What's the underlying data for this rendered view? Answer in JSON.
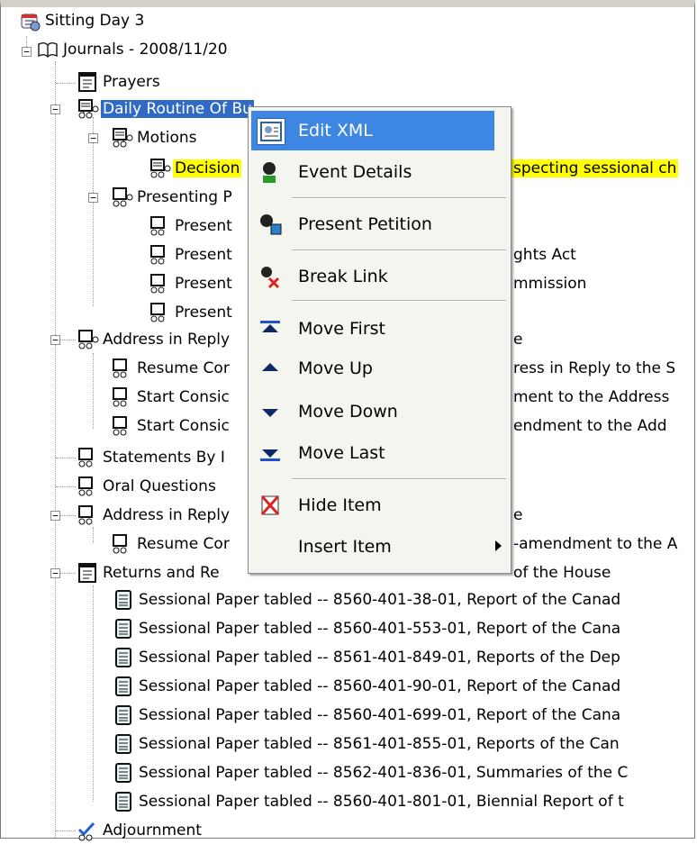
{
  "tree": {
    "root": "Sitting Day 3",
    "journal": "Journals - 2008/11/20",
    "items": [
      "Prayers",
      "Daily Routine Of Business",
      "Motions",
      "Decision on motion respecting sessional changes",
      "Presenting Petitions",
      "Present",
      "Present ... ghts Act",
      "Present ... mmission",
      "Present",
      "Address in Reply to the Speech from the Throne",
      "Resume Consideration of the Address in Reply to the S",
      "Start Consideration of amendment to the Address",
      "Start Consideration of sub-amendment to the Add",
      "Statements By Members",
      "Oral Questions",
      "Address in Reply to the Speech from the Throne",
      "Resume Consideration of sub-amendment to the A",
      "Returns and Reports Deposited with the Clerk of the House",
      "Sessional Paper tabled -- 8560-401-38-01, Report of the Canad",
      "Sessional Paper tabled -- 8560-401-553-01, Report of the Cana",
      "Sessional Paper tabled -- 8561-401-849-01, Reports of the Dep",
      "Sessional Paper tabled -- 8560-401-90-01, Report of the Canad",
      "Sessional Paper tabled -- 8560-401-699-01, Report of the Cana",
      "Sessional Paper tabled -- 8561-401-855-01, Reports of the Can",
      "Sessional Paper tabled -- 8562-401-836-01, Summaries of the C",
      "Sessional Paper tabled -- 8560-401-801-01, Biennial Report of t",
      "Adjournment"
    ],
    "visible_labels": [
      "Prayers",
      "Daily Routine Of Bu",
      "Motions",
      "Decision",
      "specting sessional ch",
      "Presenting P",
      "Present",
      "Present",
      "ghts Act",
      "Present",
      "mmission",
      "Present",
      "Address in Reply",
      "e",
      "Resume Cor",
      "ress in Reply to the S",
      "Start Consic",
      "ment to the Address",
      "Start Consic",
      "endment to the Add",
      "Statements By I",
      "Oral Questions",
      "Address in Reply",
      "e",
      "Resume Cor",
      "-amendment to the A",
      "Returns and Re",
      "of the House"
    ],
    "papers": [
      "Sessional Paper tabled -- 8560-401-38-01, Report of the Canad",
      "Sessional Paper tabled -- 8560-401-553-01, Report of the Cana",
      "Sessional Paper tabled -- 8561-401-849-01, Reports of the Dep",
      "Sessional Paper tabled -- 8560-401-90-01, Report of the Canad",
      "Sessional Paper tabled -- 8560-401-699-01, Report of the Cana",
      "Sessional Paper tabled -- 8561-401-855-01, Reports of the Can",
      "Sessional Paper tabled -- 8562-401-836-01, Summaries of the C",
      "Sessional Paper tabled -- 8560-401-801-01, Biennial Report of t"
    ],
    "adjournment": "Adjournment",
    "expand_glyph": "−"
  },
  "menu": {
    "items": [
      {
        "label": "Edit XML",
        "icon": "xml-edit-icon"
      },
      {
        "label": "Event Details",
        "icon": "person-details-icon"
      },
      {
        "label": "Present Petition",
        "icon": "petition-icon"
      },
      {
        "label": "Break Link",
        "icon": "break-link-icon"
      },
      {
        "label": "Move First",
        "icon": "move-first-icon"
      },
      {
        "label": "Move Up",
        "icon": "move-up-icon"
      },
      {
        "label": "Move Down",
        "icon": "move-down-icon"
      },
      {
        "label": "Move Last",
        "icon": "move-last-icon"
      },
      {
        "label": "Hide Item",
        "icon": "hide-item-icon"
      },
      {
        "label": "Insert Item",
        "icon": "submenu-arrow-icon"
      }
    ]
  },
  "colors": {
    "selection": "#316ac5",
    "highlight": "#ffff00",
    "menu_active": "#3d86e4",
    "menu_bg": "#f5f5f0"
  }
}
